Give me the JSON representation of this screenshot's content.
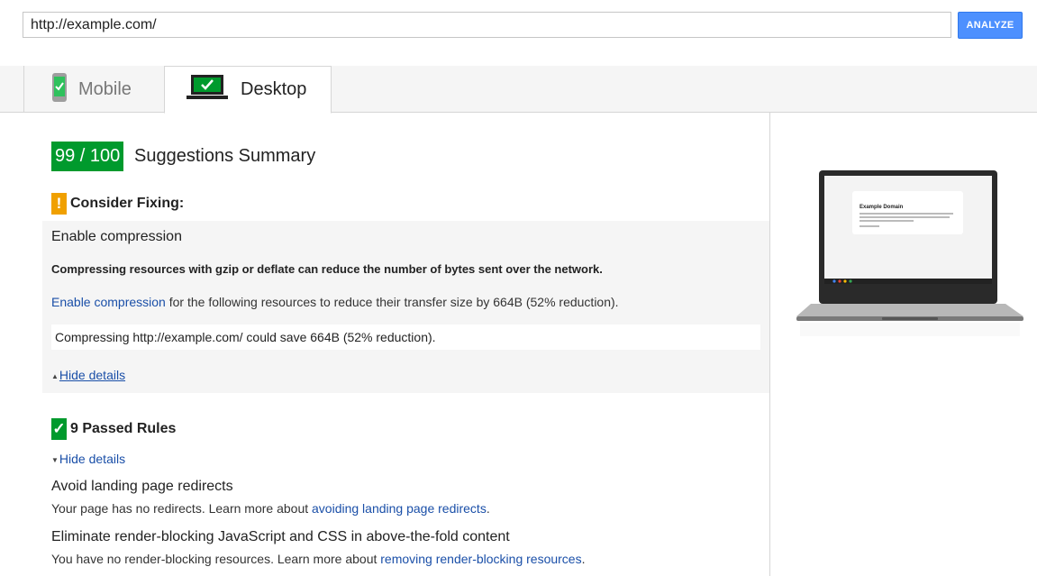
{
  "search": {
    "url": "http://example.com/"
  },
  "analyze_label": "ANALYZE",
  "tabs": [
    {
      "label": "Mobile"
    },
    {
      "label": "Desktop"
    }
  ],
  "summary": {
    "score": "99 / 100",
    "title": "Suggestions Summary"
  },
  "consider": {
    "icon_glyph": "!",
    "title": "Consider Fixing:",
    "rule_name": "Enable compression",
    "bold_text": "Compressing resources with gzip or deflate can reduce the number of bytes sent over the network.",
    "link_text": "Enable compression",
    "desc_text": " for the following resources to reduce their transfer size by 664B (52% reduction).",
    "detail": "Compressing http://example.com/ could save 664B (52% reduction).",
    "hide_details": "Hide details"
  },
  "passed": {
    "icon_glyph": "✓",
    "title": "9 Passed Rules",
    "hide_details": "Hide details",
    "rules": [
      {
        "name": "Avoid landing page redirects",
        "desc_prefix": "Your page has no redirects. Learn more about ",
        "link": "avoiding landing page redirects",
        "desc_suffix": "."
      },
      {
        "name": "Eliminate render-blocking JavaScript and CSS in above-the-fold content",
        "desc_prefix": "You have no render-blocking resources. Learn more about ",
        "link": "removing render-blocking resources",
        "desc_suffix": "."
      }
    ]
  },
  "preview": {
    "heading": "Example Domain"
  },
  "colors": {
    "score_green": "#009a2d",
    "warning_orange": "#f0a000",
    "link_blue": "#1a4fa8",
    "button_blue": "#4d90fe"
  },
  "icons": {
    "mobile_tab": "phone-check-icon",
    "desktop_tab": "laptop-check-icon"
  }
}
